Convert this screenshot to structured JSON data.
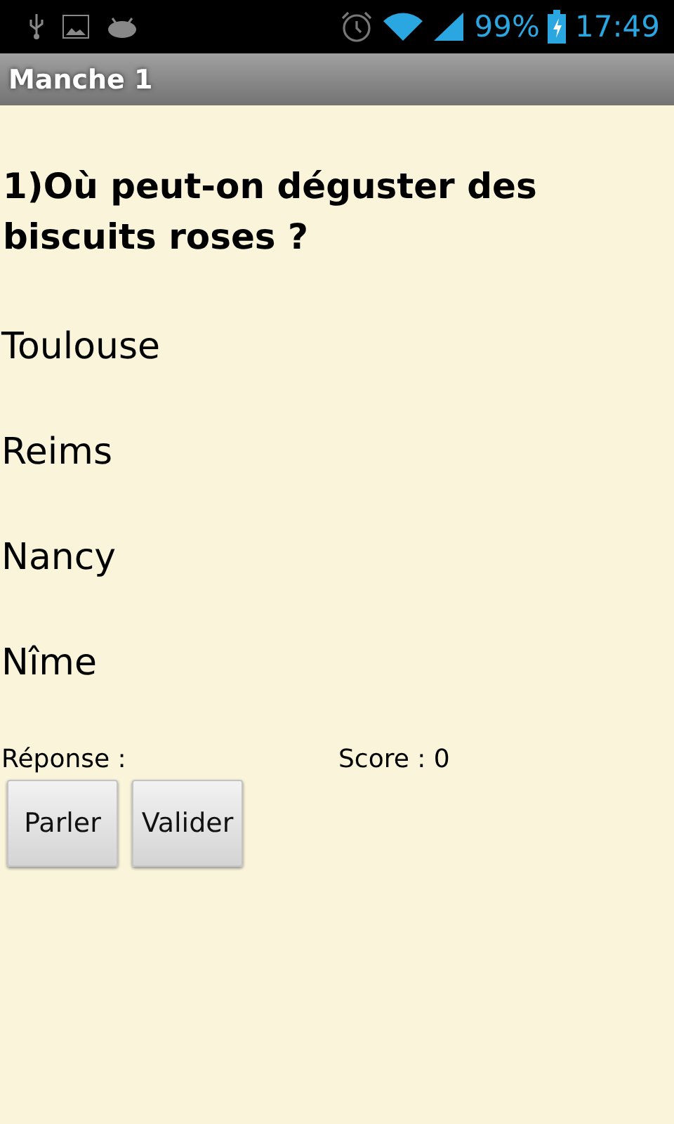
{
  "status_bar": {
    "battery": "99%",
    "time": "17:49"
  },
  "title": "Manche 1",
  "question": "1)Où peut-on déguster des biscuits roses ?",
  "answers": [
    "Toulouse",
    "Reims",
    "Nancy",
    "Nîme"
  ],
  "response_label": "Réponse :",
  "score": "Score : 0",
  "buttons": [
    "Parler",
    "Valider"
  ]
}
